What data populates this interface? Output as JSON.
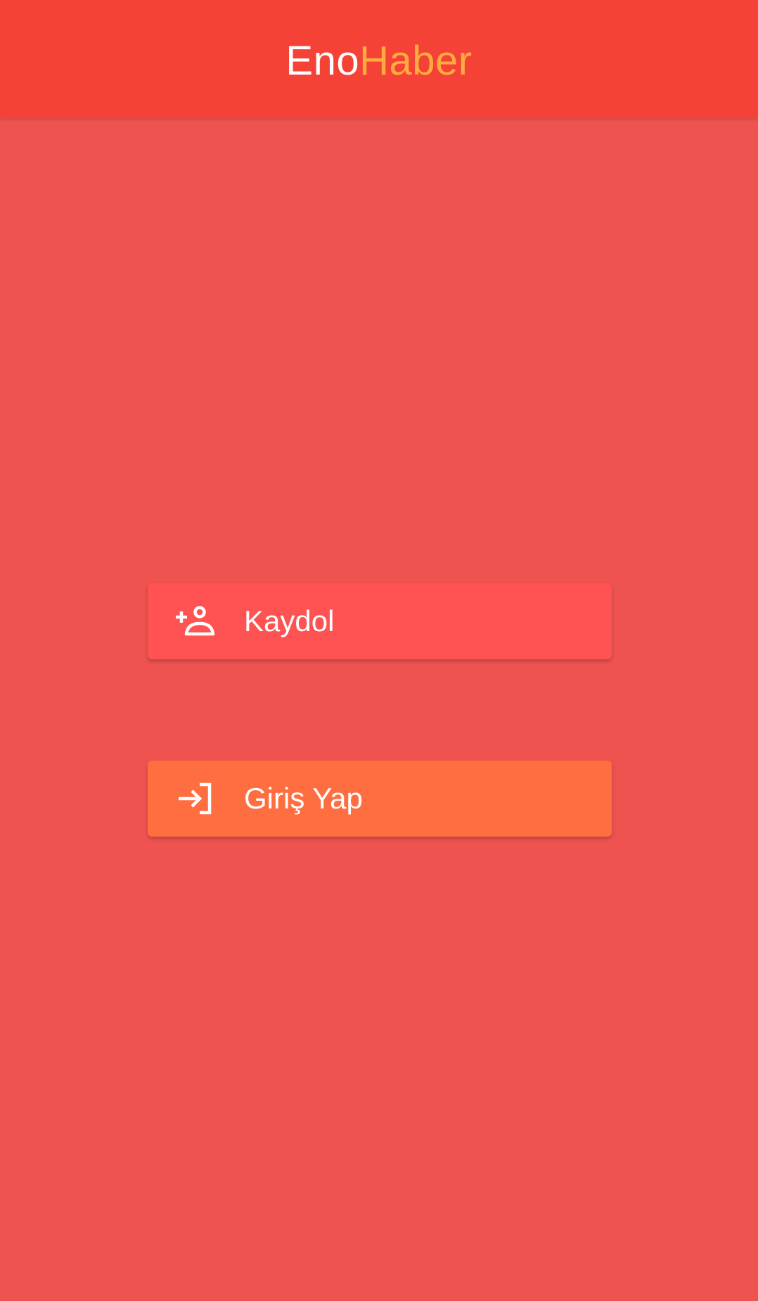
{
  "app_bar": {
    "title_part1": "Eno",
    "title_part2": "Haber"
  },
  "buttons": {
    "register": {
      "label": "Kaydol",
      "icon": "person-add-icon"
    },
    "login": {
      "label": "Giriş Yap",
      "icon": "login-icon"
    }
  },
  "colors": {
    "app_bar_background": "#F44336",
    "page_background": "#EF5350",
    "title_primary": "#FFFFFF",
    "title_accent": "#FFAB40",
    "register_button": "#FF5252",
    "login_button": "#FF6E40"
  }
}
